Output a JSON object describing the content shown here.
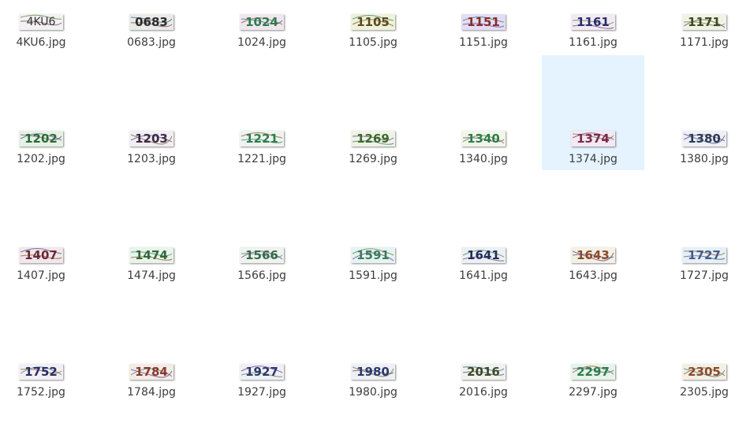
{
  "files": [
    {
      "name": "4KU6.jpg",
      "captcha": "4KU6",
      "bg": "#f2f2f2",
      "text_color": "#333333",
      "selected": false
    },
    {
      "name": "0683.jpg",
      "captcha": "0683",
      "bg": "#e8ebe6",
      "text_color": "#2b2b2b",
      "selected": false
    },
    {
      "name": "1024.jpg",
      "captcha": "1024",
      "bg": "#efe6f0",
      "text_color": "#2e7d4a",
      "selected": false
    },
    {
      "name": "1105.jpg",
      "captcha": "1105",
      "bg": "#eef2d8",
      "text_color": "#5a4a20",
      "selected": false
    },
    {
      "name": "1151.jpg",
      "captcha": "1151",
      "bg": "#e2ddf4",
      "text_color": "#8a2b2b",
      "selected": false
    },
    {
      "name": "1161.jpg",
      "captcha": "1161",
      "bg": "#f1eaf3",
      "text_color": "#2b2b6b",
      "selected": false
    },
    {
      "name": "1171.jpg",
      "captcha": "1171",
      "bg": "#eef3e6",
      "text_color": "#3c4a1c",
      "selected": false
    },
    {
      "name": "1202.jpg",
      "captcha": "1202",
      "bg": "#e6f1e6",
      "text_color": "#2b6b3a",
      "selected": false
    },
    {
      "name": "1203.jpg",
      "captcha": "1203",
      "bg": "#f3eef3",
      "text_color": "#3a2b4a",
      "selected": false
    },
    {
      "name": "1221.jpg",
      "captcha": "1221",
      "bg": "#eef3f0",
      "text_color": "#2e7d4a",
      "selected": false
    },
    {
      "name": "1269.jpg",
      "captcha": "1269",
      "bg": "#eef3e6",
      "text_color": "#3c6b2b",
      "selected": false
    },
    {
      "name": "1340.jpg",
      "captcha": "1340",
      "bg": "#f2f6ea",
      "text_color": "#2e7d4a",
      "selected": false
    },
    {
      "name": "1374.jpg",
      "captcha": "1374",
      "bg": "#f3e8f3",
      "text_color": "#7a2b4a",
      "selected": true
    },
    {
      "name": "1380.jpg",
      "captcha": "1380",
      "bg": "#eef0f6",
      "text_color": "#2b3a5a",
      "selected": false
    },
    {
      "name": "1407.jpg",
      "captcha": "1407",
      "bg": "#f3e6ea",
      "text_color": "#6b2b3a",
      "selected": false
    },
    {
      "name": "1474.jpg",
      "captcha": "1474",
      "bg": "#eaf3ea",
      "text_color": "#2e6b3a",
      "selected": false
    },
    {
      "name": "1566.jpg",
      "captcha": "1566",
      "bg": "#eef3ee",
      "text_color": "#3a6b4a",
      "selected": false
    },
    {
      "name": "1591.jpg",
      "captcha": "1591",
      "bg": "#e6f3f3",
      "text_color": "#3a7d5a",
      "selected": false
    },
    {
      "name": "1641.jpg",
      "captcha": "1641",
      "bg": "#eaf0f6",
      "text_color": "#1f2f5a",
      "selected": false
    },
    {
      "name": "1643.jpg",
      "captcha": "1643",
      "bg": "#f3f0e6",
      "text_color": "#8a4a2b",
      "selected": false
    },
    {
      "name": "1727.jpg",
      "captcha": "1727",
      "bg": "#e6f0f6",
      "text_color": "#4a5a8a",
      "selected": false
    },
    {
      "name": "1752.jpg",
      "captcha": "1752",
      "bg": "#f3f0f3",
      "text_color": "#2b2b6b",
      "selected": false
    },
    {
      "name": "1784.jpg",
      "captcha": "1784",
      "bg": "#f3ece6",
      "text_color": "#8a3a2b",
      "selected": false
    },
    {
      "name": "1927.jpg",
      "captcha": "1927",
      "bg": "#eef0f6",
      "text_color": "#2b3a6b",
      "selected": false
    },
    {
      "name": "1980.jpg",
      "captcha": "1980",
      "bg": "#eef0f6",
      "text_color": "#2b3a6b",
      "selected": false
    },
    {
      "name": "2016.jpg",
      "captcha": "2016",
      "bg": "#eef3ee",
      "text_color": "#3a4a2b",
      "selected": false
    },
    {
      "name": "2297.jpg",
      "captcha": "2297",
      "bg": "#e6f3ea",
      "text_color": "#2e7d4a",
      "selected": false
    },
    {
      "name": "2305.jpg",
      "captcha": "2305",
      "bg": "#f3efe6",
      "text_color": "#8a4a2b",
      "selected": false
    }
  ]
}
